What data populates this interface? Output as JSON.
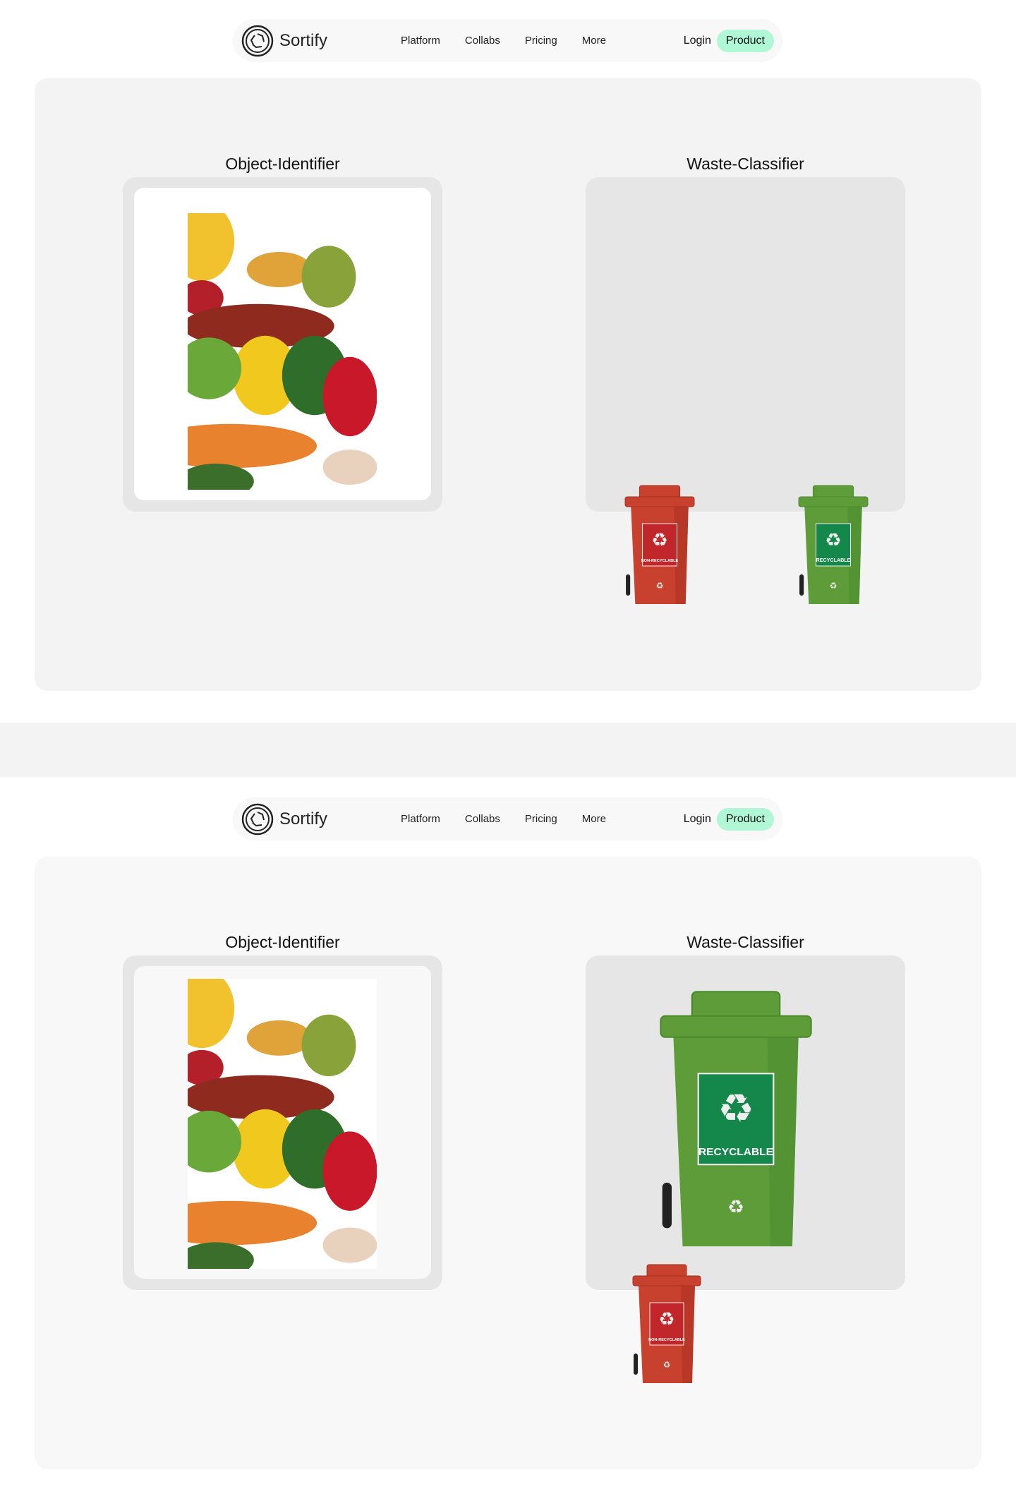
{
  "nav": {
    "brand": "Sortify",
    "links": [
      "Platform",
      "Collabs",
      "Pricing",
      "More"
    ],
    "login": "Login",
    "product": "Product",
    "accent": "#b0f7d6"
  },
  "sections": [
    {
      "object_title": "Object-Identifier",
      "classifier_title": "Waste-Classifier",
      "bins": {
        "red_label": "NON-RECYCLABLE",
        "green_label": "RECYCLABLE"
      }
    },
    {
      "object_title": "Object-Identifier",
      "classifier_title": "Waste-Classifier",
      "bins": {
        "red_label": "NON-RECYCLABLE",
        "green_label": "RECYCLABLE"
      }
    }
  ]
}
